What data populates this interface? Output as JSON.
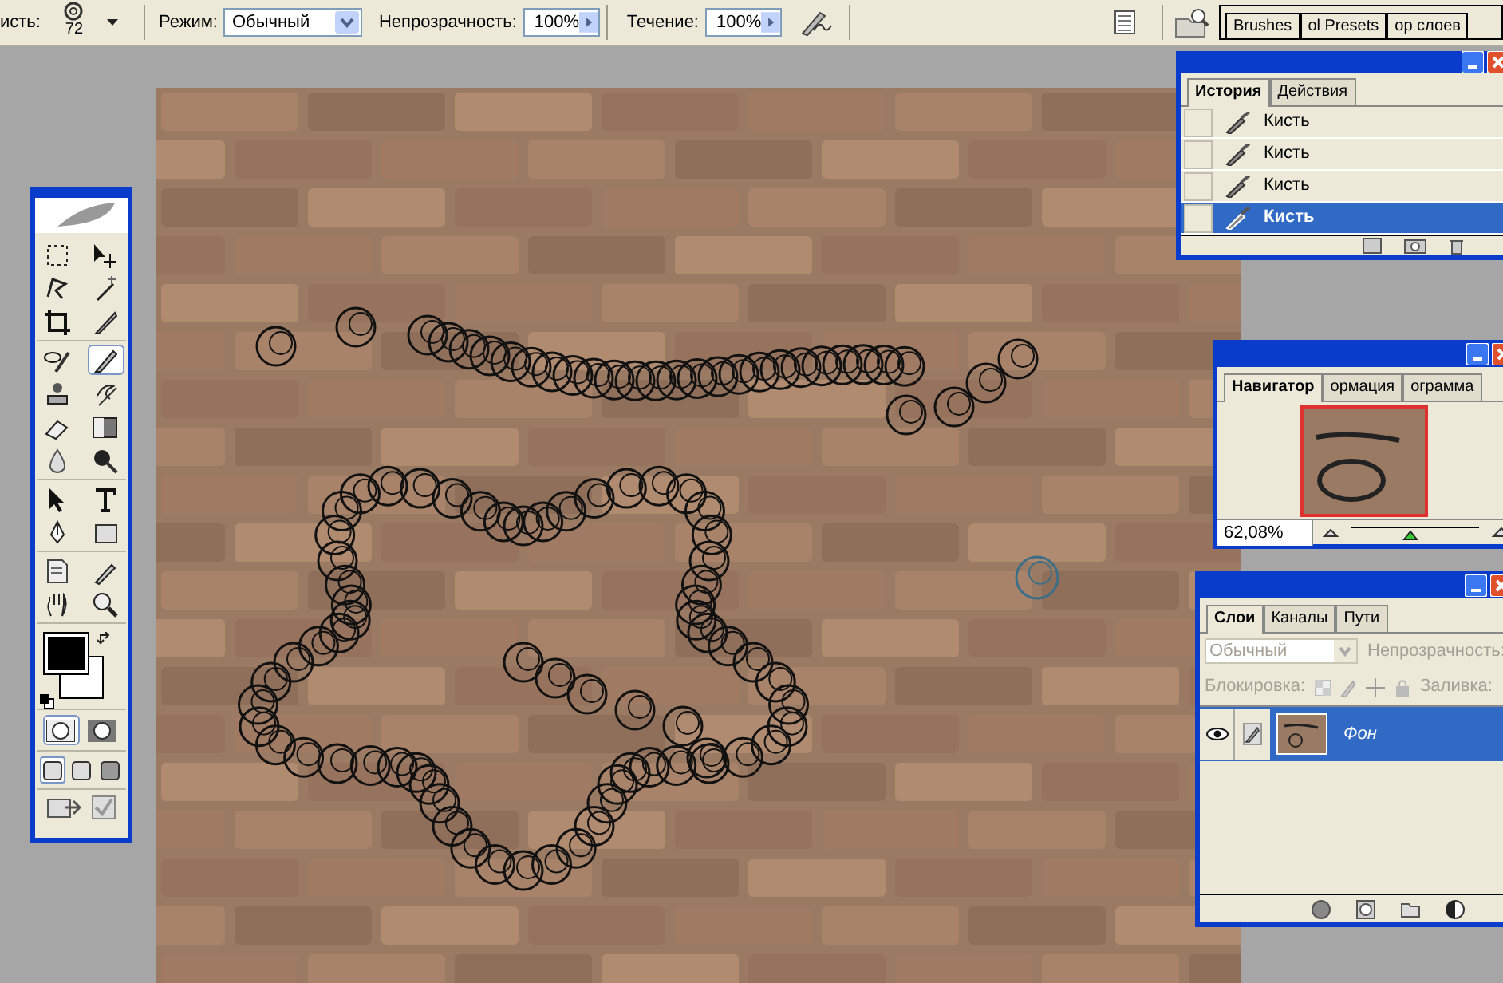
{
  "options_bar": {
    "brush_label": "исть:",
    "brush_size": "72",
    "mode_label": "Режим:",
    "mode_value": "Обычный",
    "opacity_label": "Непрозрачность:",
    "opacity_value": "100%",
    "flow_label": "Течение:",
    "flow_value": "100%"
  },
  "palette_well": {
    "tabs": [
      "Brushes",
      "ol Presets",
      "ор слоев"
    ]
  },
  "toolbox": {
    "tools": [
      {
        "selected": false
      },
      {
        "selected": false
      },
      {
        "selected": false
      },
      {
        "selected": false
      },
      {
        "selected": false
      },
      {
        "selected": false
      },
      {
        "selected": false
      },
      {
        "selected": true
      },
      {
        "selected": false
      },
      {
        "selected": false
      },
      {
        "selected": false
      },
      {
        "selected": false
      },
      {
        "selected": false
      },
      {
        "selected": false
      },
      {
        "selected": false
      },
      {
        "selected": false
      },
      {
        "selected": false
      },
      {
        "selected": false
      },
      {
        "selected": false
      },
      {
        "selected": false
      },
      {
        "selected": false
      },
      {
        "selected": false
      }
    ],
    "modes": [
      {
        "selected": true
      },
      {
        "selected": false
      }
    ],
    "screen_modes": [
      {
        "selected": true
      },
      {
        "selected": false
      },
      {
        "selected": false
      }
    ]
  },
  "history_panel": {
    "tabs": [
      {
        "label": "История",
        "selected": true
      },
      {
        "label": "Действия",
        "selected": false
      }
    ],
    "items": [
      {
        "label": "Кисть",
        "selected": false
      },
      {
        "label": "Кисть",
        "selected": false
      },
      {
        "label": "Кисть",
        "selected": false
      },
      {
        "label": "Кисть",
        "selected": true
      }
    ]
  },
  "navigator_panel": {
    "tabs": [
      {
        "label": "Навигатор",
        "selected": true
      },
      {
        "label": "ормация",
        "selected": false
      },
      {
        "label": "ограмма",
        "selected": false
      }
    ],
    "zoom": "62,08%",
    "level": 0.45
  },
  "layers_panel": {
    "tabs": [
      {
        "label": "Слои",
        "selected": true
      },
      {
        "label": "Каналы",
        "selected": false
      },
      {
        "label": "Пути",
        "selected": false
      }
    ],
    "blend_mode": "Обычный",
    "opacity_label": "Непрозрачность:",
    "lock_label": "Блокировка:",
    "fill_label": "Заливка:",
    "layers": [
      {
        "name": "Фон",
        "selected": true,
        "visible": true
      }
    ]
  }
}
